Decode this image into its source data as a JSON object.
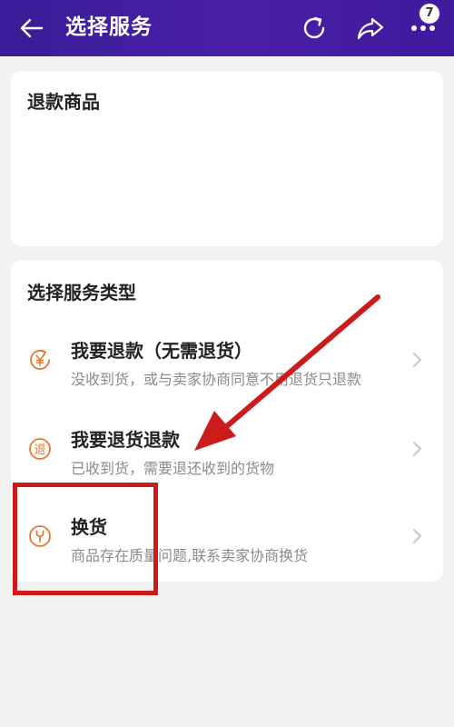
{
  "header": {
    "title": "选择服务",
    "badge_count": "7",
    "back_icon": "back-arrow-icon",
    "refresh_icon": "refresh-icon",
    "share_icon": "share-icon",
    "more_icon": "more-dots-icon"
  },
  "refund_goods": {
    "title": "退款商品"
  },
  "service_type": {
    "title": "选择服务类型",
    "options": [
      {
        "title": "我要退款（无需退货）",
        "desc": "没收到货，或与卖家协商同意不用退货只退款",
        "icon": "yen-refund-icon"
      },
      {
        "title": "我要退货退款",
        "desc": "已收到货，需要退还收到的货物",
        "icon": "return-icon"
      },
      {
        "title": "换货",
        "desc": "商品存在质量问题,联系卖家协商换货",
        "icon": "wrench-exchange-icon"
      }
    ]
  },
  "colors": {
    "header_bg": "#4a1fa8",
    "icon_orange": "#e8772e",
    "annotation_red": "#cc1b1b"
  }
}
